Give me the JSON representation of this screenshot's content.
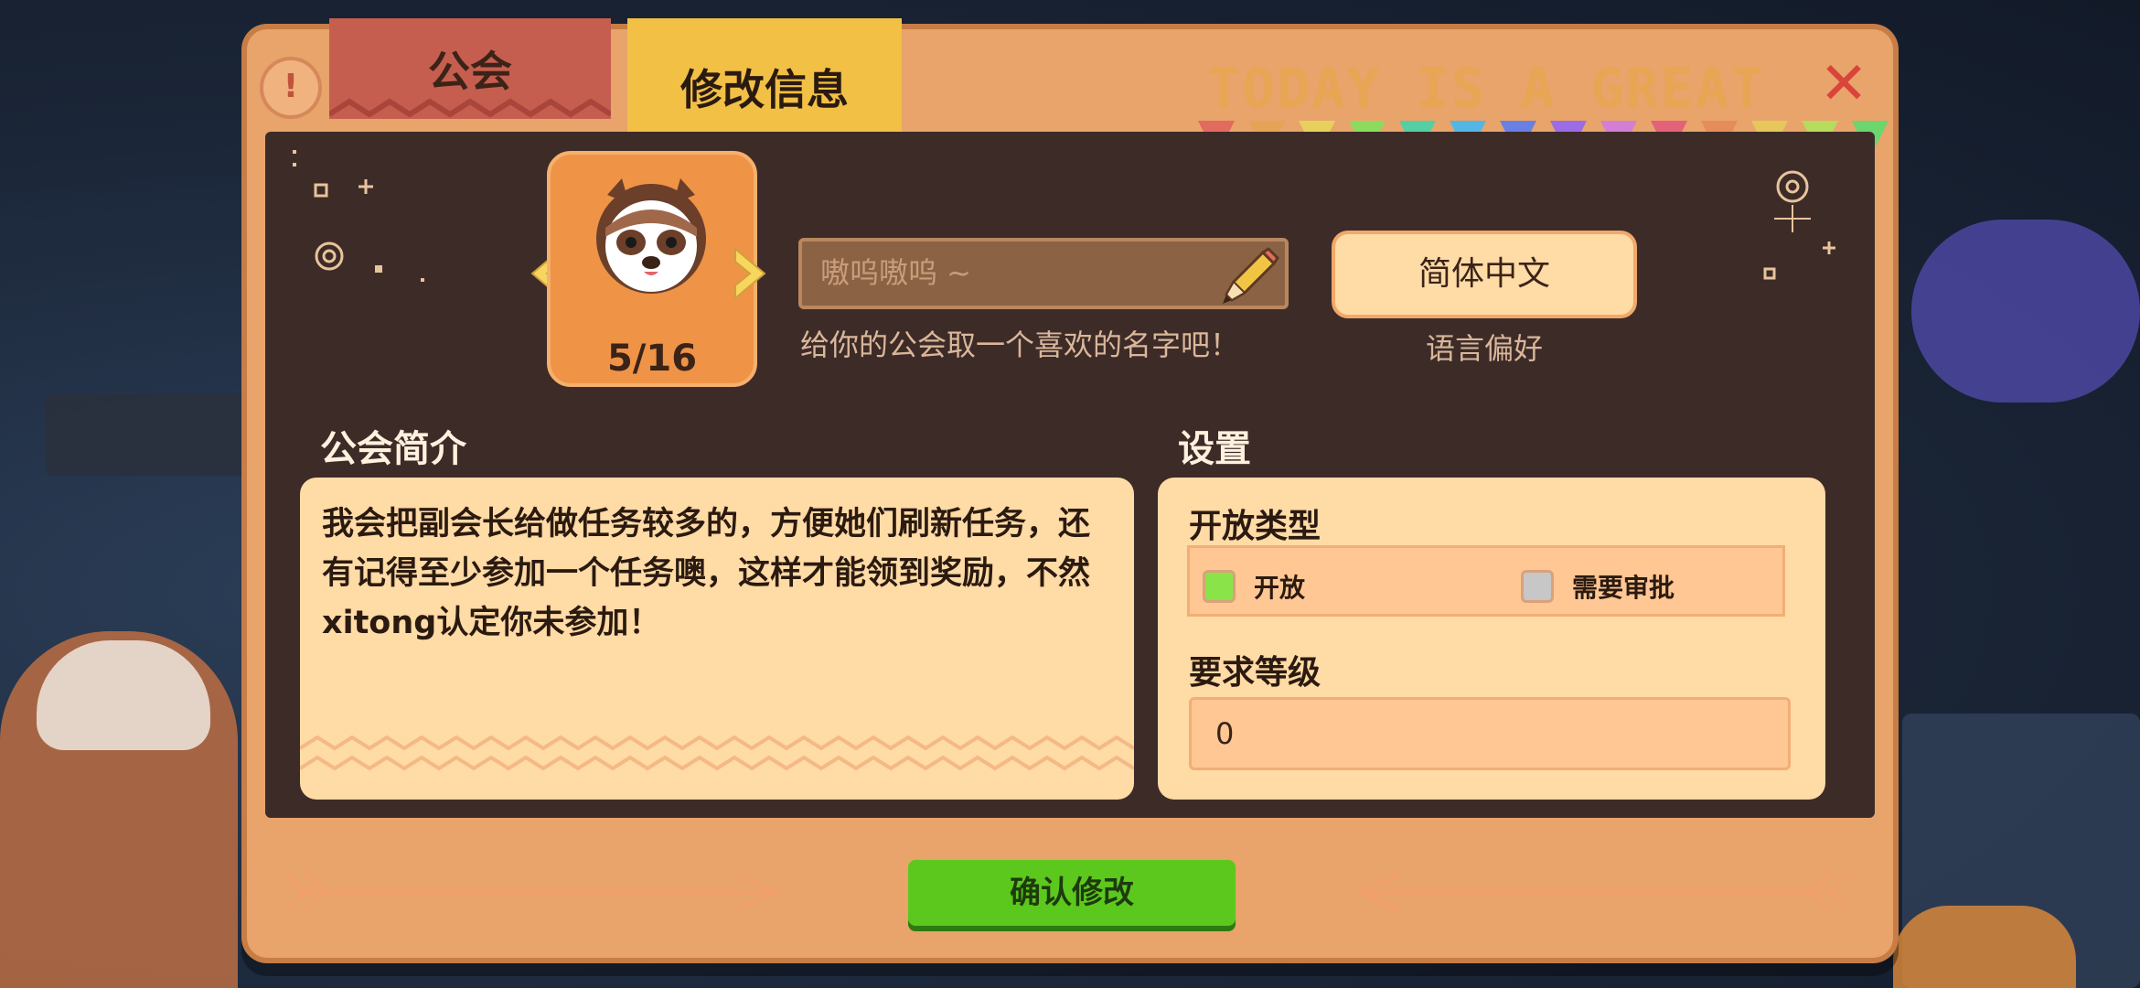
{
  "tabs": [
    {
      "label": "公会",
      "active": false
    },
    {
      "label": "修改信息",
      "active": true
    }
  ],
  "header": {
    "banner_text": "TODAY IS A GREAT DAY",
    "banner_colors": [
      "#e0535a",
      "#e57a56",
      "#e8a554",
      "#9b6cf0",
      "#57a9ef",
      "#e9e07c",
      "#eac65a",
      "#eac65a",
      "#eabf5a"
    ]
  },
  "avatar": {
    "count": "5/16"
  },
  "guild_name": {
    "placeholder": "嗷呜嗷呜 ~",
    "hint": "给你的公会取一个喜欢的名字吧！"
  },
  "language": {
    "value": "简体中文",
    "label": "语言偏好"
  },
  "intro": {
    "title": "公会简介",
    "text": "我会把副会长给做任务较多的，方便她们刷新任务，还有记得至少参加一个任务噢，这样才能领到奖励，不然xitong认定你未参加！"
  },
  "settings": {
    "title": "设置",
    "open_type_label": "开放类型",
    "options": [
      {
        "label": "开放",
        "selected": true,
        "color": "#8be34a"
      },
      {
        "label": "需要审批",
        "selected": false,
        "color": "#c7c7c7"
      }
    ],
    "level_label": "要求等级",
    "level_value": "0"
  },
  "confirm_label": "确认修改",
  "colors": {
    "frame": "#e8a46a",
    "panel": "#3d2b28",
    "cream": "#ffdba6",
    "confirm_green": "#5cc81e",
    "close_red": "#d9443b"
  }
}
